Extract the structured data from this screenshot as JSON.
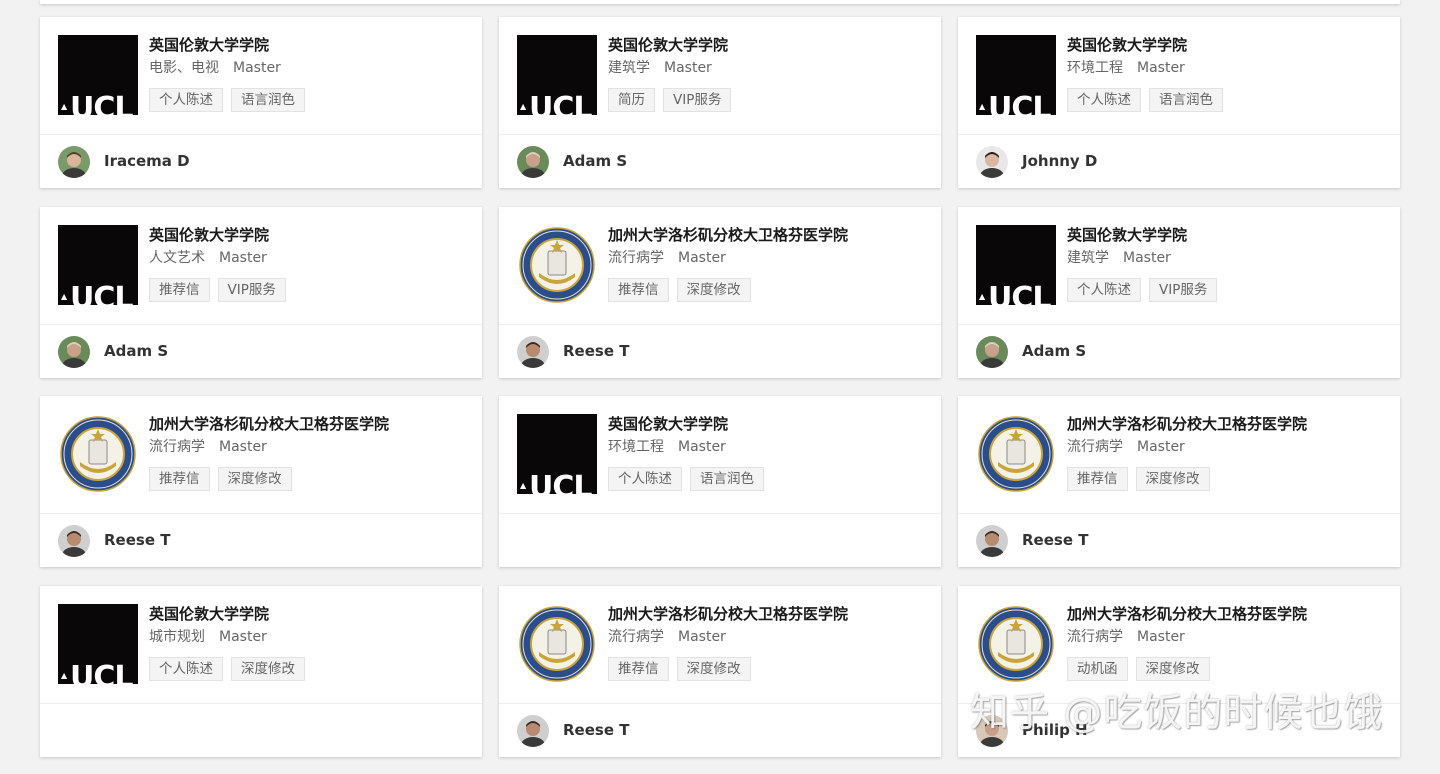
{
  "cards": [
    {
      "school": "英国伦敦大学学院",
      "major": "电影、电视",
      "degree": "Master",
      "tags": [
        "个人陈述",
        "语言润色"
      ],
      "logo": "ucl-logo",
      "logo_text": "UCL",
      "user": "Iracema D",
      "avatar": "avatar-woman"
    },
    {
      "school": "英国伦敦大学学院",
      "major": "建筑学",
      "degree": "Master",
      "tags": [
        "简历",
        "VIP服务"
      ],
      "logo": "ucl-logo",
      "logo_text": "UCL",
      "user": "Adam S",
      "avatar": "avatar-man-a"
    },
    {
      "school": "英国伦敦大学学院",
      "major": "环境工程",
      "degree": "Master",
      "tags": [
        "个人陈述",
        "语言润色"
      ],
      "logo": "ucl-logo",
      "logo_text": "UCL",
      "user": "Johnny D",
      "avatar": "avatar-man-j"
    },
    {
      "school": "英国伦敦大学学院",
      "major": "人文艺术",
      "degree": "Master",
      "tags": [
        "推荐信",
        "VIP服务"
      ],
      "logo": "ucl-logo",
      "logo_text": "UCL",
      "user": "Adam S",
      "avatar": "avatar-man-a"
    },
    {
      "school": "加州大学洛杉矶分校大卫格芬医学院",
      "major": "流行病学",
      "degree": "Master",
      "tags": [
        "推荐信",
        "深度修改"
      ],
      "logo": "ucla-seal-logo",
      "user": "Reese T",
      "avatar": "avatar-man-r"
    },
    {
      "school": "英国伦敦大学学院",
      "major": "建筑学",
      "degree": "Master",
      "tags": [
        "个人陈述",
        "VIP服务"
      ],
      "logo": "ucl-logo",
      "logo_text": "UCL",
      "user": "Adam S",
      "avatar": "avatar-man-a"
    },
    {
      "school": "加州大学洛杉矶分校大卫格芬医学院",
      "major": "流行病学",
      "degree": "Master",
      "tags": [
        "推荐信",
        "深度修改"
      ],
      "logo": "ucla-seal-logo",
      "user": "Reese T",
      "avatar": "avatar-man-r"
    },
    {
      "school": "英国伦敦大学学院",
      "major": "环境工程",
      "degree": "Master",
      "tags": [
        "个人陈述",
        "语言润色"
      ],
      "logo": "ucl-logo",
      "logo_text": "UCL",
      "user": "",
      "avatar": ""
    },
    {
      "school": "加州大学洛杉矶分校大卫格芬医学院",
      "major": "流行病学",
      "degree": "Master",
      "tags": [
        "推荐信",
        "深度修改"
      ],
      "logo": "ucla-seal-logo",
      "user": "Reese T",
      "avatar": "avatar-man-r"
    },
    {
      "school": "英国伦敦大学学院",
      "major": "城市规划",
      "degree": "Master",
      "tags": [
        "个人陈述",
        "深度修改"
      ],
      "logo": "ucl-logo",
      "logo_text": "UCL",
      "user": "",
      "avatar": ""
    },
    {
      "school": "加州大学洛杉矶分校大卫格芬医学院",
      "major": "流行病学",
      "degree": "Master",
      "tags": [
        "推荐信",
        "深度修改"
      ],
      "logo": "ucla-seal-logo",
      "user": "Reese T",
      "avatar": "avatar-man-r"
    },
    {
      "school": "加州大学洛杉矶分校大卫格芬医学院",
      "major": "流行病学",
      "degree": "Master",
      "tags": [
        "动机函",
        "深度修改"
      ],
      "logo": "ucla-seal-logo",
      "user": "Philip H",
      "avatar": "avatar-man-p"
    }
  ],
  "watermark": "知乎 @吃饭的时候也饿",
  "colors": {
    "page_bg": "#f2f2f2",
    "card_bg": "#ffffff",
    "ucl_bg": "#0a0708",
    "seal_blue": "#2b4d8c",
    "seal_gold": "#c9a43a"
  }
}
